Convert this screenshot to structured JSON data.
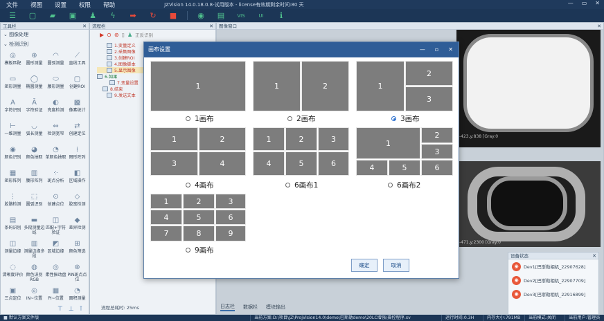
{
  "menubar": {
    "items": [
      "文件",
      "视图",
      "设置",
      "权限",
      "帮助"
    ],
    "title": "JZVision 14.0.18.0.8-试用版本 - license有效期剩余时间:80 天",
    "window_controls": [
      "—",
      "▭",
      "✕"
    ]
  },
  "toolbar": {
    "icons": [
      "list-icon",
      "new-file-icon",
      "open-folder-icon",
      "save-icon",
      "user-icon",
      "run-once-icon",
      "run-loop-icon",
      "refresh-icon",
      "stop-icon",
      "camera-icon",
      "device-icon",
      "vis-icon",
      "ui-icon",
      "info-icon"
    ]
  },
  "toolbox": {
    "title": "工具栏",
    "section": "图像处理",
    "subsection": "检测识别",
    "tools": [
      "模板匹配",
      "圆形测量",
      "圆弧测量",
      "直线工具",
      "矩形测量",
      "椭圆测量",
      "腰形测量",
      "创建ROI",
      "字符识别",
      "字符验证",
      "亮度检测",
      "像素统计",
      "一维测量",
      "弧长测量",
      "检测宽窄",
      "创建定位",
      "颜色识别",
      "颜色抽取",
      "单颜色抽取",
      "图形阵列",
      "矩形阵列",
      "腰形阵列",
      "斑点分析",
      "区域操作",
      "胶路检测",
      "圆弧识别",
      "创建点位",
      "胶宽检测",
      "条码识别",
      "多段测量边线",
      "匹配+字符验证",
      "差异检测",
      "测量边缘",
      "测量边缘多段",
      "区域边缘",
      "颜色筛选",
      "清晰度评价",
      "颜色识别RGB",
      "柔性振动盘",
      "PIN斑点点位",
      "三点定位",
      "IN~位置",
      "PI~位置",
      "面积测量"
    ]
  },
  "flow": {
    "title": "流程栏",
    "run_label": "正反识别",
    "items": [
      "1.变量定义",
      "2.采集图像",
      "3.创建ROI",
      "4.图像脚本",
      "5.显示图像",
      "6.如果",
      "7.变量设置",
      "8.结束",
      "9.发送文本"
    ],
    "total_time": "流程总耗时: 25ms"
  },
  "image_window": {
    "title": "图像窗口",
    "cam1_text": "-423,y:838 [Gray:0",
    "cam2_text": "-471,y:2300 [Gray:0"
  },
  "device_status": {
    "title": "设备状态",
    "devices": [
      "Dev1[巴斯勒相机_22907628]",
      "Dev2[巴斯勒相机_22907709]",
      "Dev3[巴斯勒相机_22916899]"
    ]
  },
  "log_tabs": [
    "日志栏",
    "数据栏",
    "模块输出"
  ],
  "statusbar": {
    "left": "■ 默认方案文件版",
    "path": "当前方案:D:\\项目\\JZ\\ProjVision14.0\\demo\\巴斯勒demo\\20LC增强\\操控程序.sv",
    "t1": "运行时间:0.3H",
    "t2": "内存大小:791MB",
    "t3": "当前模式:关闭",
    "t4": "当前用户:管理员"
  },
  "dialog": {
    "title": "画布设置",
    "controls": [
      "—",
      "▫",
      "✕"
    ],
    "options": [
      "1画布",
      "2画布",
      "3画布",
      "4画布",
      "6画布1",
      "6画布2",
      "9画布"
    ],
    "selected": "3画布",
    "ok": "确定",
    "cancel": "取消",
    "cells": {
      "c1": [
        "1"
      ],
      "c2": [
        "1",
        "2"
      ],
      "c3": [
        "1",
        "2",
        "3"
      ],
      "c4": [
        "1",
        "2",
        "3",
        "4"
      ],
      "c61": [
        "1",
        "2",
        "3",
        "4",
        "5",
        "6"
      ],
      "c62": [
        "1",
        "2",
        "3",
        "4",
        "5",
        "6"
      ],
      "c9": [
        "1",
        "2",
        "3",
        "4",
        "5",
        "6",
        "7",
        "8",
        "9"
      ]
    }
  }
}
